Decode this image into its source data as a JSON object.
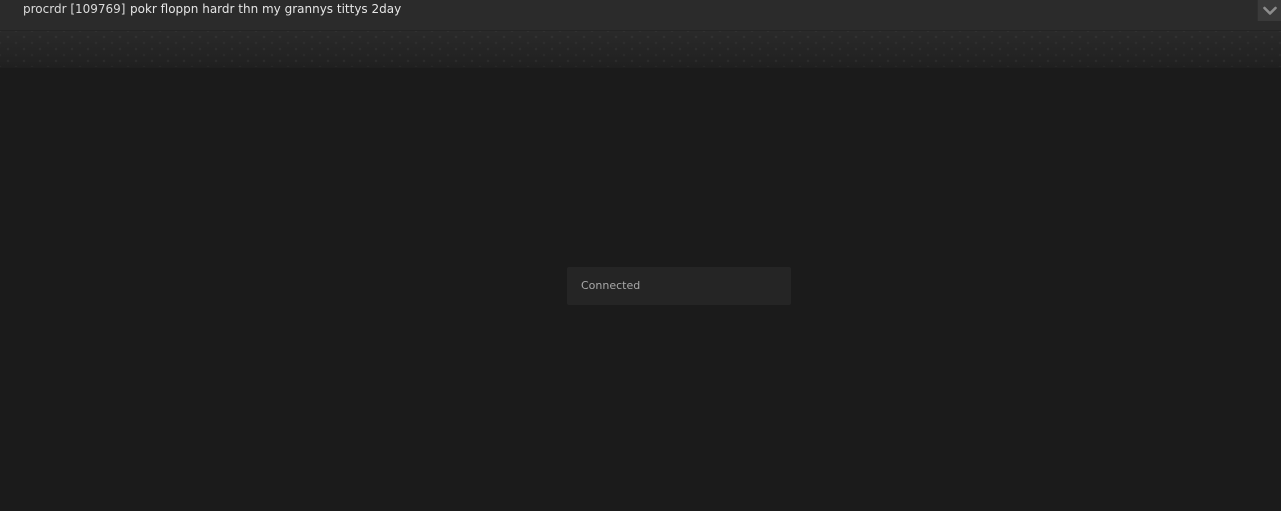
{
  "header": {
    "user": "procrdr [109769]",
    "status": "pokr floppn hardr thn my grannys tittys 2day",
    "collapse_icon": "chevron-down-icon"
  },
  "toast": {
    "message": "Connected"
  },
  "colors": {
    "background": "#1b1b1b",
    "topbar": "#2b2b2b",
    "toast": "#252525",
    "text": "#e6e6e6",
    "muted_text": "#a8a8a8"
  }
}
